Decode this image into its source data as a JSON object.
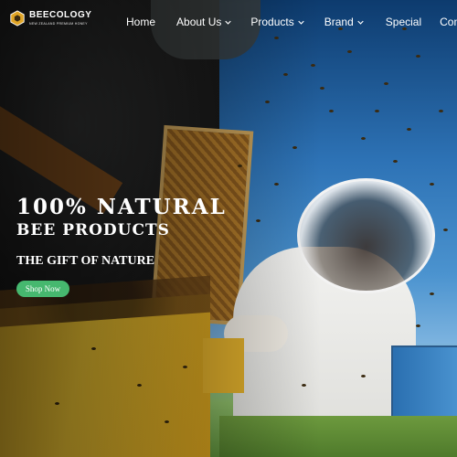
{
  "brand": {
    "name": "BEECOLOGY",
    "tagline": "NEW ZEALAND PREMIUM HONEY",
    "icon": "honeycomb-logo-icon",
    "accent": "#46b86f"
  },
  "nav": {
    "items": [
      {
        "label": "Home",
        "has_dropdown": false
      },
      {
        "label": "About Us",
        "has_dropdown": true
      },
      {
        "label": "Products",
        "has_dropdown": true
      },
      {
        "label": "Brand",
        "has_dropdown": true
      },
      {
        "label": "Special",
        "has_dropdown": false
      },
      {
        "label": "Contact",
        "has_dropdown": false
      }
    ],
    "dropdown_icon": "chevron-down-icon"
  },
  "hero": {
    "headline_line1": "100% NATURAL",
    "headline_line2": "BEE PRODUCTS",
    "subheading": "THE GIFT OF NATURE",
    "cta_label": "Shop Now"
  }
}
